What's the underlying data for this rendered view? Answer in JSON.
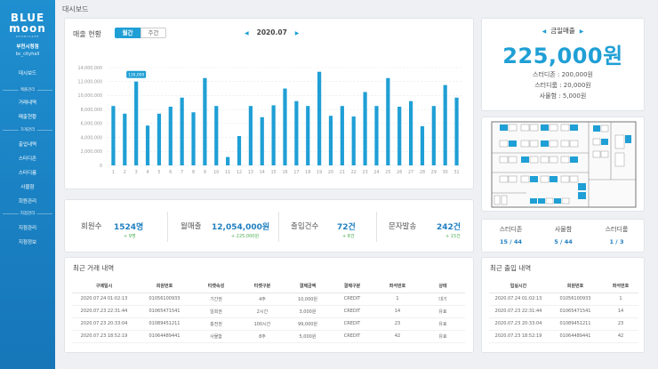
{
  "sidebar": {
    "logo": {
      "line1": "BLUE",
      "line2": "moon",
      "tagline": "STUDYCAFE"
    },
    "store_name": "부천시청점",
    "store_id": "bc_cityhall",
    "dashboard": "대시보드",
    "sections": [
      {
        "title": "매출관리",
        "items": [
          "거래내역",
          "매출현황"
        ]
      },
      {
        "title": "가게관리",
        "items": [
          "출입내역",
          "스터디존",
          "스터디룸",
          "사물함",
          "회원관리"
        ]
      },
      {
        "title": "지점관리",
        "items": [
          "지점관리",
          "지점정보"
        ]
      }
    ]
  },
  "page_title": "대시보드",
  "chart_card": {
    "title": "매출 현황",
    "tab_monthly": "월간",
    "tab_weekly": "주간",
    "month": "2020.07",
    "prev_icon": "triangle-left-icon",
    "next_icon": "triangle-right-icon"
  },
  "chart_data": {
    "type": "bar",
    "title": "",
    "xlabel": "",
    "ylabel": "",
    "categories": [
      "1",
      "2",
      "3",
      "4",
      "5",
      "6",
      "7",
      "8",
      "9",
      "10",
      "11",
      "12",
      "13",
      "14",
      "15",
      "16",
      "17",
      "18",
      "19",
      "20",
      "21",
      "22",
      "23",
      "24",
      "25",
      "26",
      "27",
      "28",
      "29",
      "30",
      "31"
    ],
    "values": [
      8500000,
      7400000,
      12000000,
      5700000,
      7400000,
      8400000,
      9700000,
      7600000,
      12500000,
      8500000,
      1200000,
      4200000,
      8500000,
      6900000,
      8600000,
      11000000,
      9200000,
      8500000,
      13400000,
      7100000,
      8500000,
      7000000,
      10500000,
      8500000,
      12500000,
      8400000,
      9200000,
      5600000,
      8500000,
      11500000,
      9700000
    ],
    "highlight": {
      "index": 2,
      "label": "130,000"
    },
    "ylim": [
      0,
      14000000
    ],
    "yticks": [
      "0",
      "2,000,000",
      "4,000,000",
      "6,000,000",
      "8,000,000",
      "10,000,000",
      "12,000,000",
      "14,000,000"
    ],
    "grid": true,
    "color": "#1f9fd5"
  },
  "today": {
    "title": "금일매출",
    "total": "225,000원",
    "lines": [
      "스터디존 : 200,000원",
      "스터디룸 : 20,000원",
      "사물함 : 5,000원"
    ]
  },
  "stats": [
    {
      "label": "회원수",
      "value": "1524명",
      "sub": "+ 9명"
    },
    {
      "label": "월매출",
      "value": "12,054,000원",
      "sub": "+ 225,000원"
    },
    {
      "label": "출입건수",
      "value": "72건",
      "sub": "+ 8건"
    },
    {
      "label": "문자발송",
      "value": "242건",
      "sub": "+ 15건"
    }
  ],
  "seat_counts": [
    {
      "label": "스터디존",
      "value": "15 / 44"
    },
    {
      "label": "사물함",
      "value": "5 / 44"
    },
    {
      "label": "스터디룸",
      "value": "1 / 3"
    }
  ],
  "transactions": {
    "title": "최근 거래 내역",
    "headers": [
      "구매일시",
      "회원번호",
      "티켓속성",
      "티켓구분",
      "결제금액",
      "결제구분",
      "좌석번호",
      "상태"
    ],
    "rows": [
      [
        "2020.07.24 01:02:13",
        "01056100933",
        "기간권",
        "4주",
        "10,000원",
        "CREDIT",
        "1",
        "대기"
      ],
      [
        "2020.07.23 22:31:44",
        "01065471541",
        "일회권",
        "2시간",
        "3,000원",
        "CREDIT",
        "14",
        "유효"
      ],
      [
        "2020.07.23 20:33:04",
        "01089451211",
        "충전권",
        "100시간",
        "99,000원",
        "CREDIT",
        "23",
        "유효"
      ],
      [
        "2020.07.23 18:52:19",
        "01064489441",
        "사물함",
        "8주",
        "5,000원",
        "CREDIT",
        "42",
        "유효"
      ]
    ]
  },
  "entries": {
    "title": "최근 출입 내역",
    "headers": [
      "입실시간",
      "회원번호",
      "좌석번호"
    ],
    "rows": [
      [
        "2020.07.24 01:02:13",
        "01056100933",
        "1"
      ],
      [
        "2020.07.23 22:31:44",
        "01065471541",
        "14"
      ],
      [
        "2020.07.23 20:33:04",
        "01089451211",
        "23"
      ],
      [
        "2020.07.23 18:52:19",
        "01064489441",
        "42"
      ]
    ]
  }
}
